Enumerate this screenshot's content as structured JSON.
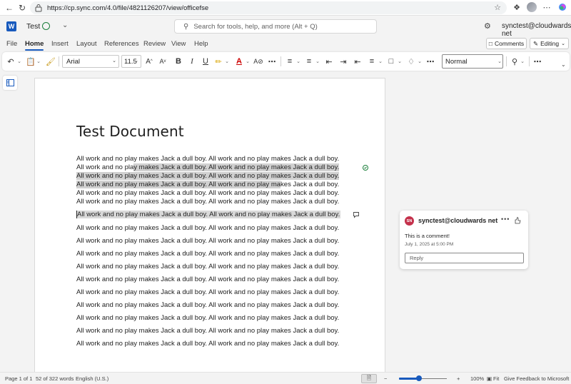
{
  "browser": {
    "url": "https://cp.sync.com/4.0/file/4821126207/view/officefse"
  },
  "app": {
    "logo_letter": "W",
    "doc_name": "Test",
    "search_placeholder": "Search for tools, help, and more (Alt + Q)",
    "account": "synctest@cloudwards net",
    "accent_color": "#185abd"
  },
  "menu": {
    "tabs": [
      "File",
      "Home",
      "Insert",
      "Layout",
      "References",
      "Review",
      "View",
      "Help"
    ],
    "active_tab": "Home",
    "comments_label": "Comments",
    "editing_label": "Editing"
  },
  "ribbon": {
    "font": "Arial",
    "size": "11.5",
    "style": "Normal",
    "bold": "B",
    "italic": "I",
    "underline": "U"
  },
  "document": {
    "title": "Test Document",
    "para1_plain_a": "All work and no play makes Jack a dull boy. All work and no play makes Jack a dull boy. All work and no pla",
    "para1_highlight": "y makes Jack a dull boy. All work and no play makes Jack a dull boy. All work and no play makes Jack a dull boy. All work and no play makes Jack a dull boy. All work and no play makes Jack a dull boy. All work and no play ma",
    "para1_plain_b": "kes Jack a dull boy. All work and no play makes Jack a dull boy. All work and no play makes Jack a dull boy. All work and no play makes Jack a dull boy. All work and no play makes Jack a dull boy.",
    "selected_line": "All work and no play makes Jack a dull boy. All work and no play makes Jack a dull boy.",
    "lines": [
      "All work and no play makes Jack a dull boy. All work and no play makes Jack a dull boy.",
      "All work and no play makes Jack a dull boy. All work and no play makes Jack a dull boy.",
      "All work and no play makes Jack a dull boy. All work and no play makes Jack a dull boy.",
      "All work and no play makes Jack a dull boy. All work and no play makes Jack a dull boy.",
      "All work and no play makes Jack a dull boy. All work and no play makes Jack a dull boy.",
      "All work and no play makes Jack a dull boy. All work and no play makes Jack a dull boy.",
      "All work and no play makes Jack a dull boy. All work and no play makes Jack a dull boy.",
      "All work and no play makes Jack a dull boy. All work and no play makes Jack a dull boy.",
      "All work and no play makes Jack a dull boy. All work and no play makes Jack a dull boy.",
      "All work and no play makes Jack a dull boy. All work and no play makes Jack a dull boy."
    ]
  },
  "comment": {
    "initials": "SN",
    "author": "synctest@cloudwards net",
    "more": "•••",
    "text": "This is a comment!",
    "date": "July 1, 2025 at 5:00 PM",
    "reply_placeholder": "Reply",
    "avatar_color": "#c4314b"
  },
  "status": {
    "page": "Page 1 of 1",
    "words": "52 of 322 words",
    "language": "English (U.S.)",
    "zoom_level": 0.42,
    "zoom": "100%",
    "fit": "Fit",
    "feedback": "Give Feedback to Microsoft"
  }
}
